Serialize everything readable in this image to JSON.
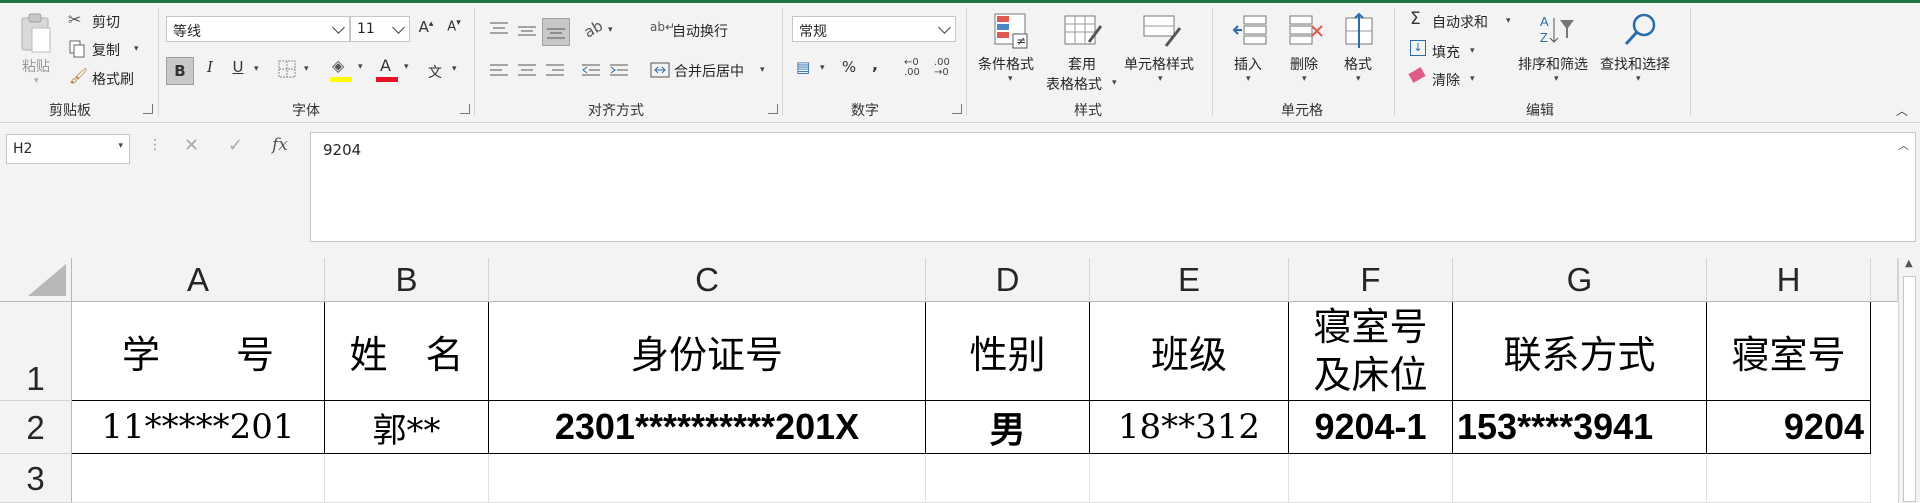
{
  "ribbon": {
    "clipboard": {
      "group_label": "剪贴板",
      "paste": "粘贴",
      "cut": "剪切",
      "copy": "复制",
      "format_painter": "格式刷"
    },
    "font": {
      "group_label": "字体",
      "font_name": "等线",
      "font_size": "11",
      "grow_font": "A",
      "shrink_font": "A",
      "bold": "B",
      "italic": "I",
      "underline": "U",
      "phonetic": "文"
    },
    "alignment": {
      "group_label": "对齐方式",
      "wrap_text": "自动换行",
      "merge_center": "合并后居中"
    },
    "number": {
      "group_label": "数字",
      "format": "常规",
      "percent": "%",
      "comma": ","
    },
    "styles": {
      "group_label": "样式",
      "conditional_formatting": "条件格式",
      "format_as_table_line1": "套用",
      "format_as_table_line2": "表格格式",
      "cell_styles": "单元格样式"
    },
    "cells": {
      "group_label": "单元格",
      "insert": "插入",
      "delete": "删除",
      "format": "格式"
    },
    "editing": {
      "group_label": "编辑",
      "autosum": "自动求和",
      "fill": "填充",
      "clear": "清除",
      "sort_filter": "排序和筛选",
      "find_select": "查找和选择"
    }
  },
  "formula_bar": {
    "name_box": "H2",
    "fx": "fx",
    "content": "9204"
  },
  "sheet": {
    "columns": [
      "A",
      "B",
      "C",
      "D",
      "E",
      "F",
      "G",
      "H"
    ],
    "rows": [
      "1",
      "2",
      "3"
    ],
    "header_row": {
      "A": "学　　号",
      "B": "姓　名",
      "C": "身份证号",
      "D": "性别",
      "E": "班级",
      "F_line1": "寝室号",
      "F_line2": "及床位",
      "G": "联系方式",
      "H": "寝室号"
    },
    "data_row": {
      "A": "11*****201",
      "B": "郭**",
      "C": "2301**********201X",
      "D": "男",
      "E": "18**312",
      "F": "9204-1",
      "G": "153****3941",
      "H": "9204"
    }
  },
  "colors": {
    "accent": "#217346",
    "ribbon_bg": "#f3f3f3",
    "font_color_bar": "#e81123",
    "highlight_bar": "#ffff00"
  }
}
